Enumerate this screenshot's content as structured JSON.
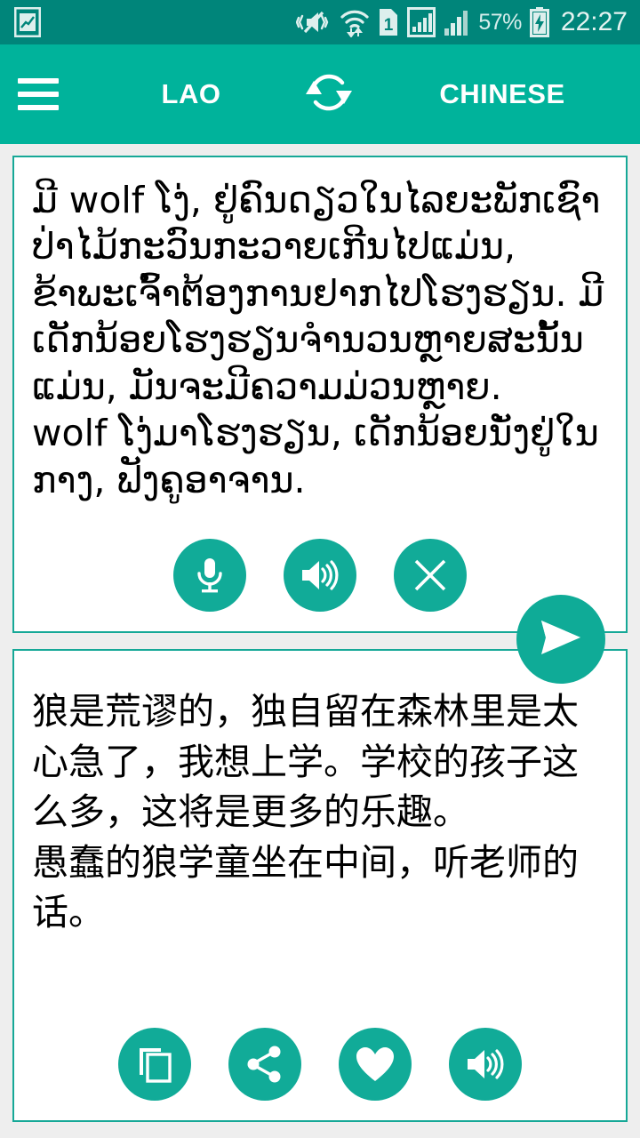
{
  "status_bar": {
    "icons": [
      {
        "name": "screenshot-icon"
      },
      {
        "name": "vibrate-mute-icon"
      },
      {
        "name": "wifi-transfer-icon"
      },
      {
        "name": "sim-1-icon",
        "label": "1"
      },
      {
        "name": "signal-bars-sim1-icon"
      },
      {
        "name": "signal-bars-sim2-icon"
      }
    ],
    "battery_percent": "57%",
    "battery_charging": true,
    "clock": "22:27"
  },
  "toolbar": {
    "menu_icon": "hamburger-menu-icon",
    "source_language": "LAO",
    "swap_icon": "swap-languages-icon",
    "target_language": "CHINESE"
  },
  "source_card": {
    "text": "ມີ wolf ໂງ່, ຢູ່ຄົນດຽວໃນໄລຍະພັກເຊົາປ່າໄມ້ກະວົນກະວາຍເກີນໄປແມ່ນ, ຂ້າພະເຈົ້າຕ້ອງການຢາກໄປໂຮງຮຽນ. ມີເດັກນ້ອຍໂຮງຮຽນຈໍານວນຫຼາຍສະນັ້ນແມ່ນ, ມັນຈະມີຄວາມມ່ວນຫຼາຍ.\nwolf ໂງ່ມາໂຮງຮຽນ, ເດັກນ້ອຍນັ່ງຢູ່ໃນກາງ, ຟັງຄູອາຈານ.",
    "actions": [
      {
        "name": "microphone-button",
        "icon": "microphone-icon"
      },
      {
        "name": "speak-source-button",
        "icon": "speaker-icon"
      },
      {
        "name": "clear-text-button",
        "icon": "close-x-icon"
      }
    ]
  },
  "translate_fab": {
    "name": "translate-send-button",
    "icon": "send-paper-plane-icon"
  },
  "target_card": {
    "text": "狼是荒谬的，独自留在森林里是太心急了，我想上学。学校的孩子这么多，这将是更多的乐趣。\n愚蠢的狼学童坐在中间，听老师的话。",
    "actions": [
      {
        "name": "copy-translation-button",
        "icon": "copy-icon"
      },
      {
        "name": "share-translation-button",
        "icon": "share-icon"
      },
      {
        "name": "favorite-translation-button",
        "icon": "heart-icon"
      },
      {
        "name": "speak-translation-button",
        "icon": "speaker-icon"
      }
    ]
  },
  "colors": {
    "status_bar_bg": "#00857a",
    "toolbar_bg": "#00b39b",
    "accent": "#11ab98",
    "card_border": "#16a897",
    "page_bg": "#eeeeee",
    "card_bg": "#ffffff",
    "text": "#000000"
  }
}
